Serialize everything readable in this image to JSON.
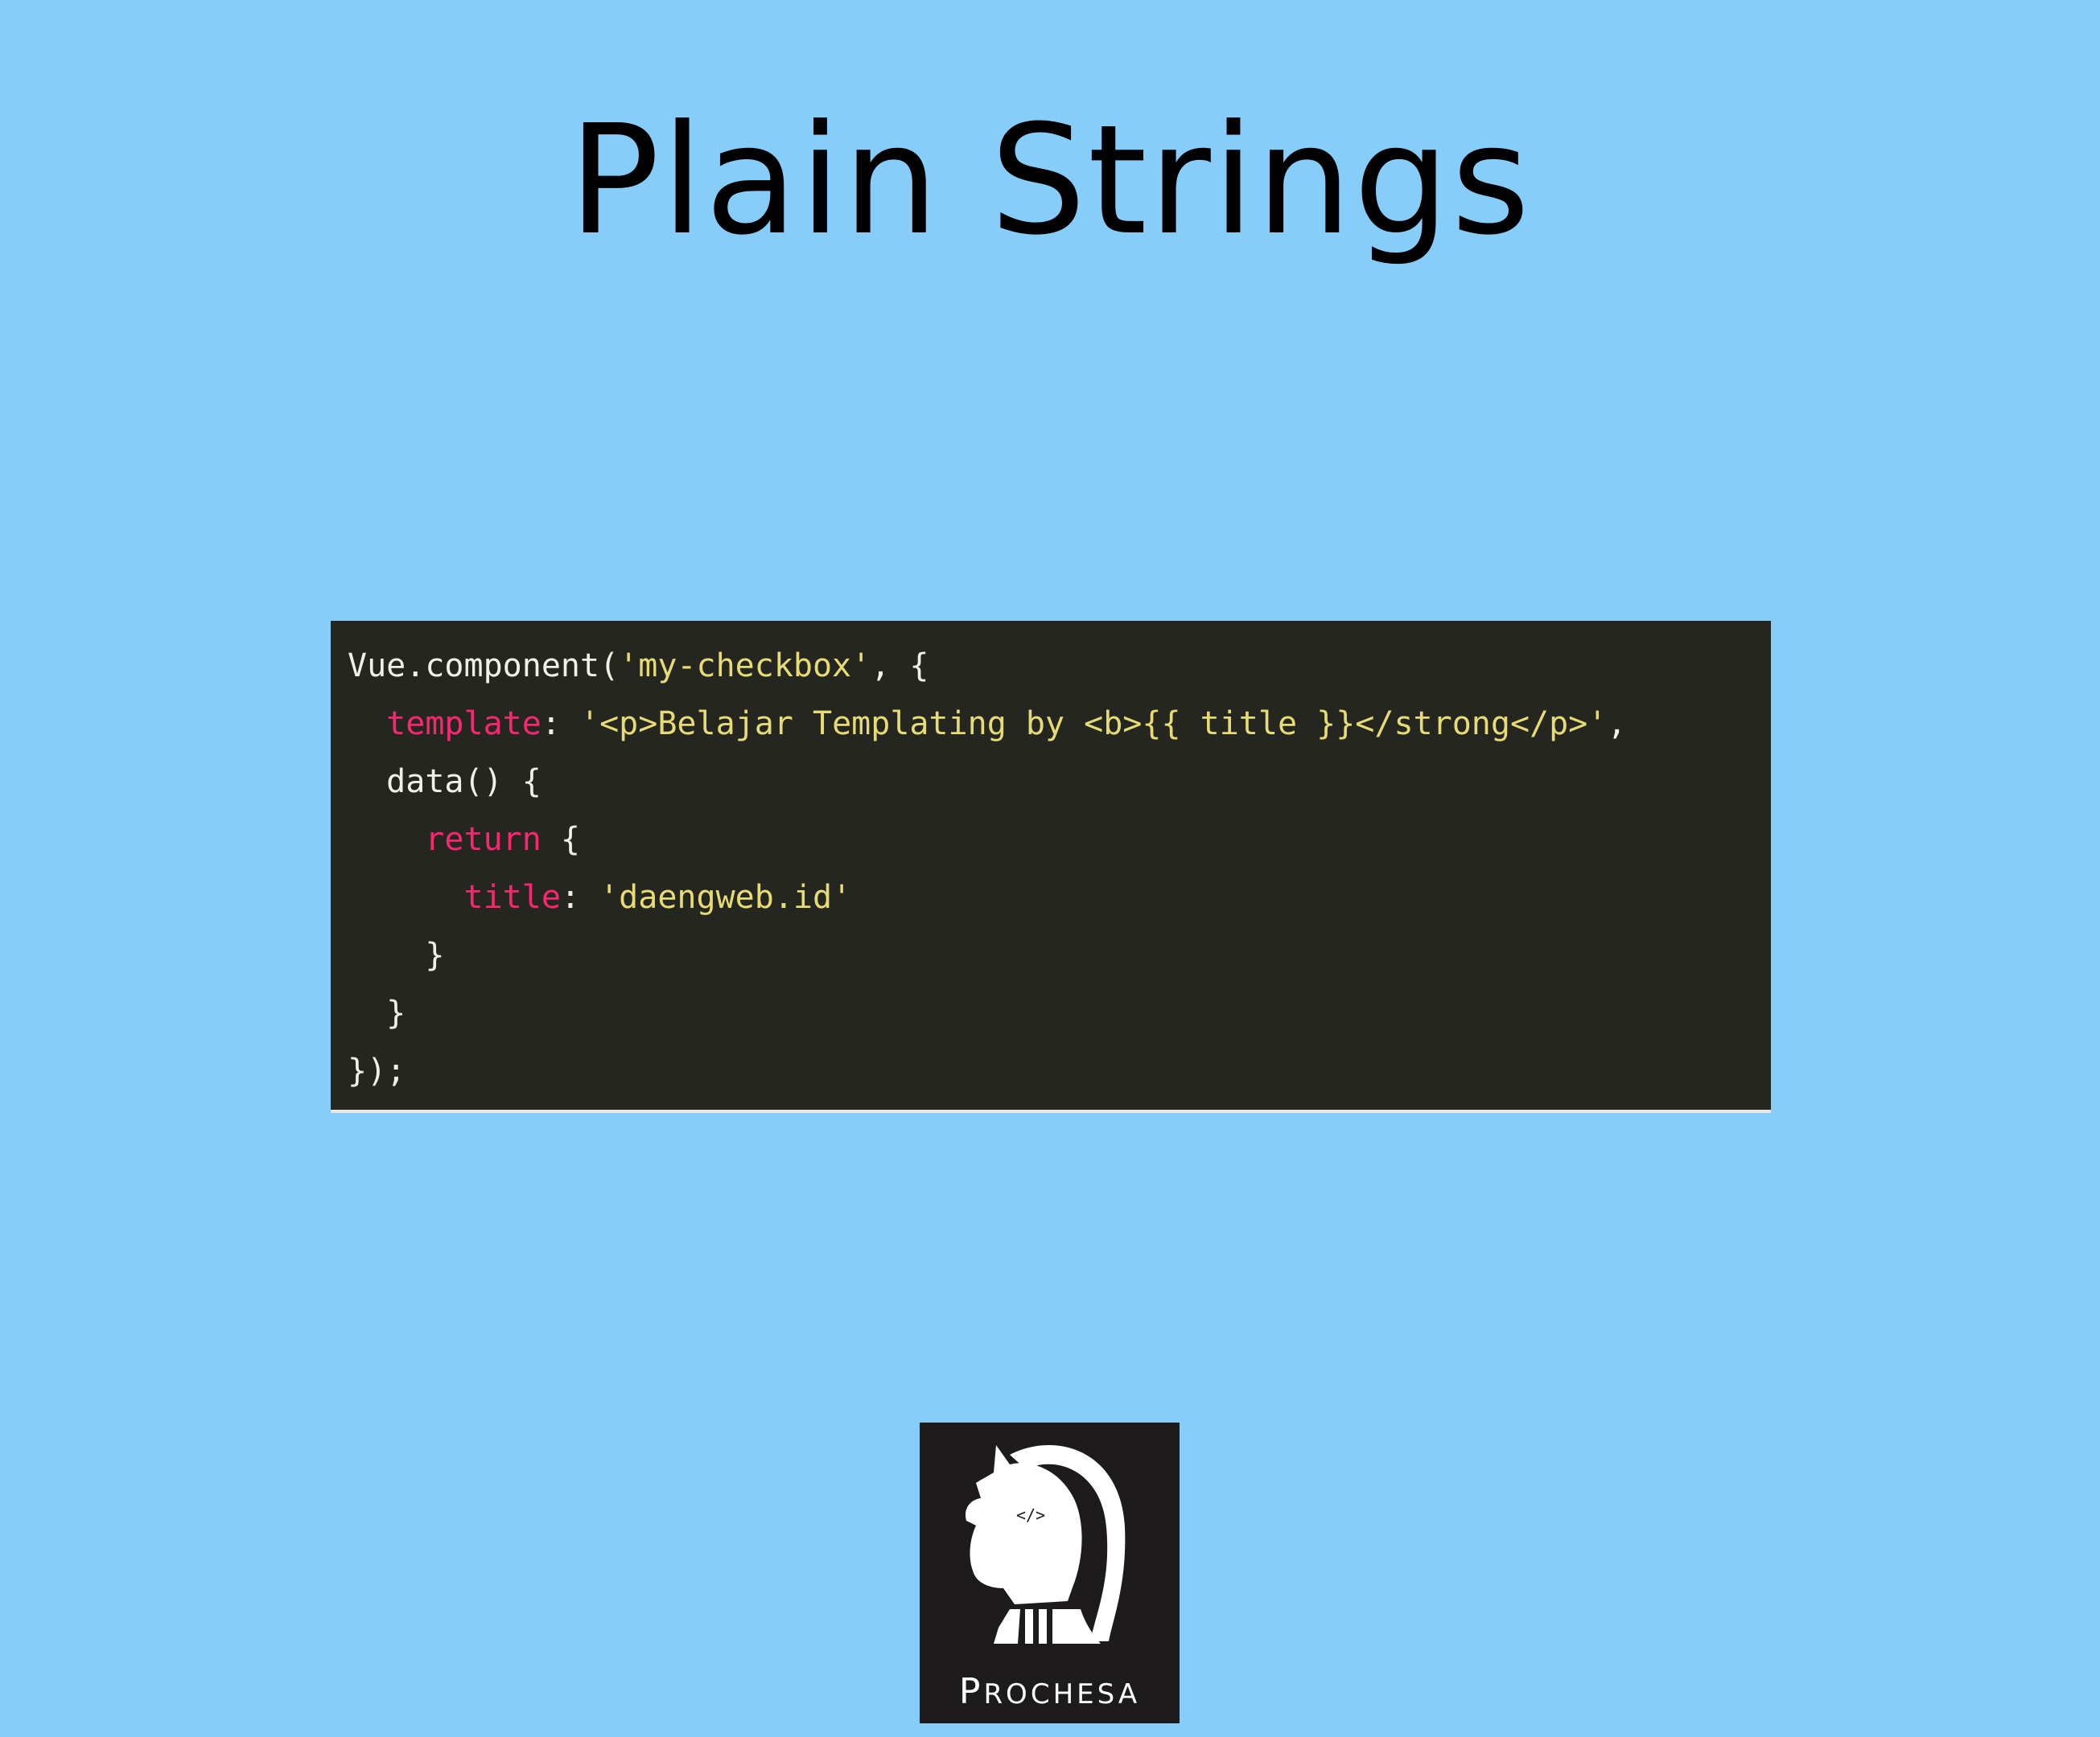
{
  "slide": {
    "title": "Plain Strings"
  },
  "code": {
    "lines": [
      {
        "indent": "",
        "tokens": [
          {
            "t": "plain",
            "v": "Vue.component("
          },
          {
            "t": "str",
            "v": "'my-checkbox'"
          },
          {
            "t": "plain",
            "v": ", {"
          }
        ]
      },
      {
        "indent": "  ",
        "tokens": [
          {
            "t": "key",
            "v": "template"
          },
          {
            "t": "plain",
            "v": ": "
          },
          {
            "t": "str",
            "v": "'<p>Belajar Templating by <b>{{ title }}</strong</p>'"
          },
          {
            "t": "plain",
            "v": ","
          }
        ]
      },
      {
        "indent": "  ",
        "tokens": [
          {
            "t": "plain",
            "v": "data() {"
          }
        ]
      },
      {
        "indent": "    ",
        "tokens": [
          {
            "t": "key",
            "v": "return"
          },
          {
            "t": "plain",
            "v": " {"
          }
        ]
      },
      {
        "indent": "      ",
        "tokens": [
          {
            "t": "key",
            "v": "title"
          },
          {
            "t": "plain",
            "v": ": "
          },
          {
            "t": "str",
            "v": "'daengweb.id'"
          }
        ]
      },
      {
        "indent": "    ",
        "tokens": [
          {
            "t": "plain",
            "v": "}"
          }
        ]
      },
      {
        "indent": "  ",
        "tokens": [
          {
            "t": "plain",
            "v": "}"
          }
        ]
      },
      {
        "indent": "",
        "tokens": [
          {
            "t": "plain",
            "v": "});"
          }
        ]
      }
    ]
  },
  "logo": {
    "icon": "knight-chess-piece-icon",
    "mark_text": "</>",
    "brand_first": "P",
    "brand_rest": "ROCHESA"
  },
  "colors": {
    "background": "#87CDF9",
    "code_background": "#252620",
    "code_plain": "#F0F0E8",
    "code_string": "#E6DB74",
    "code_keyword": "#F92672",
    "logo_background": "#1D1B1C"
  }
}
